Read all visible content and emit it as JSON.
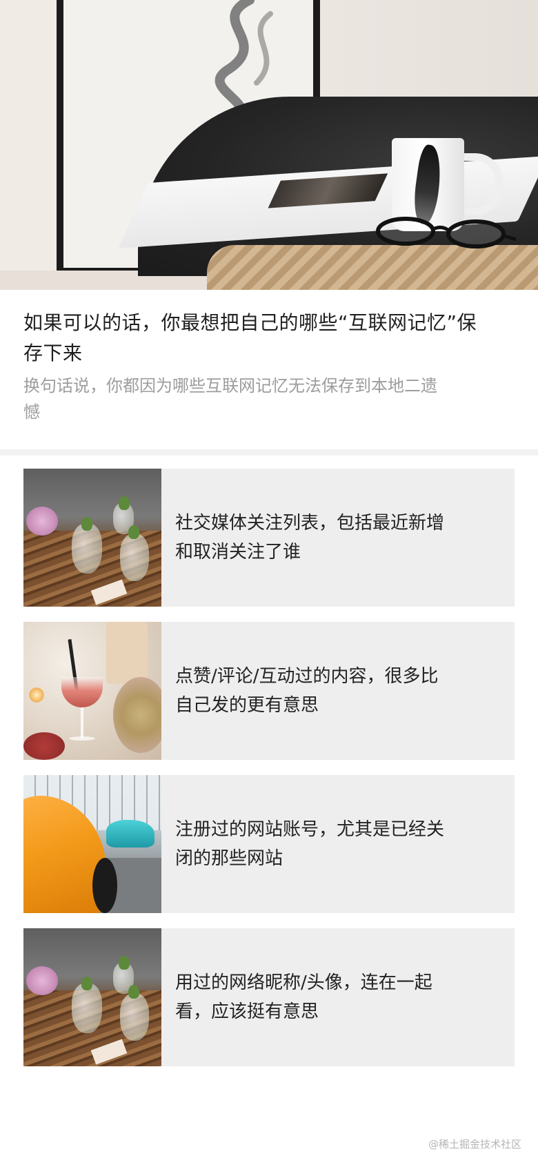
{
  "article": {
    "title": "如果可以的话，你最想把自己的哪些“互联网记忆”保存下来",
    "subtitle": "换句话说，你都因为哪些互联网记忆无法保存到本地二遗憾"
  },
  "items": [
    {
      "text": "社交媒体关注列表，包括最近新增和取消关注了谁",
      "image": "flowers-on-table"
    },
    {
      "text": "点赞/评论/互动过的内容，很多比自己发的更有意思",
      "image": "cocktail-glass"
    },
    {
      "text": "注册过的网站账号，尤其是已经关闭的那些网站",
      "image": "sports-cars"
    },
    {
      "text": "用过的网络昵称/头像，连在一起看，应该挺有意思",
      "image": "flowers-on-table"
    }
  ],
  "footer": {
    "watermark": "@稀土掘金技术社区"
  }
}
